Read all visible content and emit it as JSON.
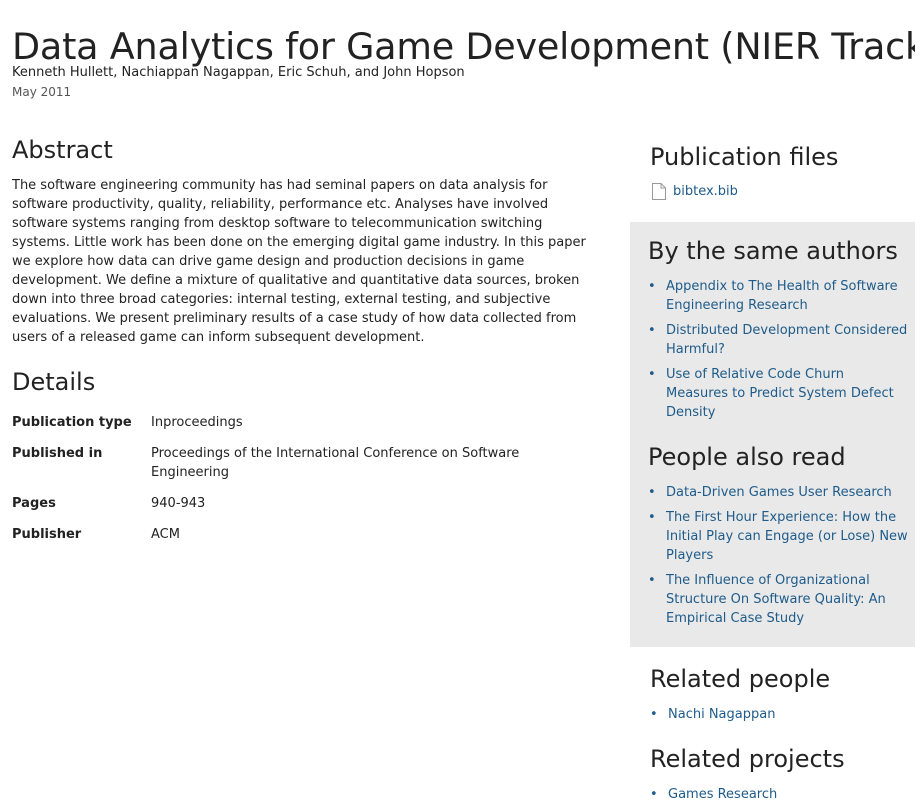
{
  "header": {
    "title": "Data Analytics for Game Development (NIER Track)",
    "authors": "Kenneth Hullett, Nachiappan Nagappan, Eric Schuh, and John Hopson",
    "date": "May 2011"
  },
  "abstract": {
    "heading": "Abstract",
    "text": "The software engineering community has had seminal papers on data analysis for software productivity, quality, reliability, performance etc. Analyses have involved software systems ranging from desktop software to telecommunication switching systems. Little work has been done on the emerging digital game industry. In this paper we explore how data can drive game design and production decisions in game development. We define a mixture of qualitative and quantitative data sources, broken down into three broad categories: internal testing, external testing, and subjective evaluations. We present preliminary results of a case study of how data collected from users of a released game can inform subsequent development."
  },
  "details": {
    "heading": "Details",
    "rows": [
      {
        "label": "Publication type",
        "value": "Inproceedings"
      },
      {
        "label": "Published in",
        "value": "Proceedings of the International Conference on Software Engineering"
      },
      {
        "label": "Pages",
        "value": "940-943"
      },
      {
        "label": "Publisher",
        "value": "ACM"
      }
    ]
  },
  "sidebar": {
    "publication_files": {
      "heading": "Publication files",
      "file_label": "bibtex.bib",
      "icon": "file-icon"
    },
    "same_authors": {
      "heading": "By the same authors",
      "items": [
        "Appendix to The Health of Software Engineering Research",
        "Distributed Development Considered Harmful?",
        "Use of Relative Code Churn Measures to Predict System Defect Density"
      ]
    },
    "people_also_read": {
      "heading": "People also read",
      "items": [
        "Data-Driven Games User Research",
        "The First Hour Experience: How the Initial Play can Engage (or Lose) New Players",
        "The Influence of Organizational Structure On Software Quality: An Empirical Case Study"
      ]
    },
    "related_people": {
      "heading": "Related people",
      "items": [
        "Nachi Nagappan"
      ]
    },
    "related_projects": {
      "heading": "Related projects",
      "items": [
        "Games Research"
      ]
    }
  },
  "colors": {
    "link": "#1e5b8a",
    "sidebar_background": "#e9e9e9",
    "text": "#222222"
  }
}
